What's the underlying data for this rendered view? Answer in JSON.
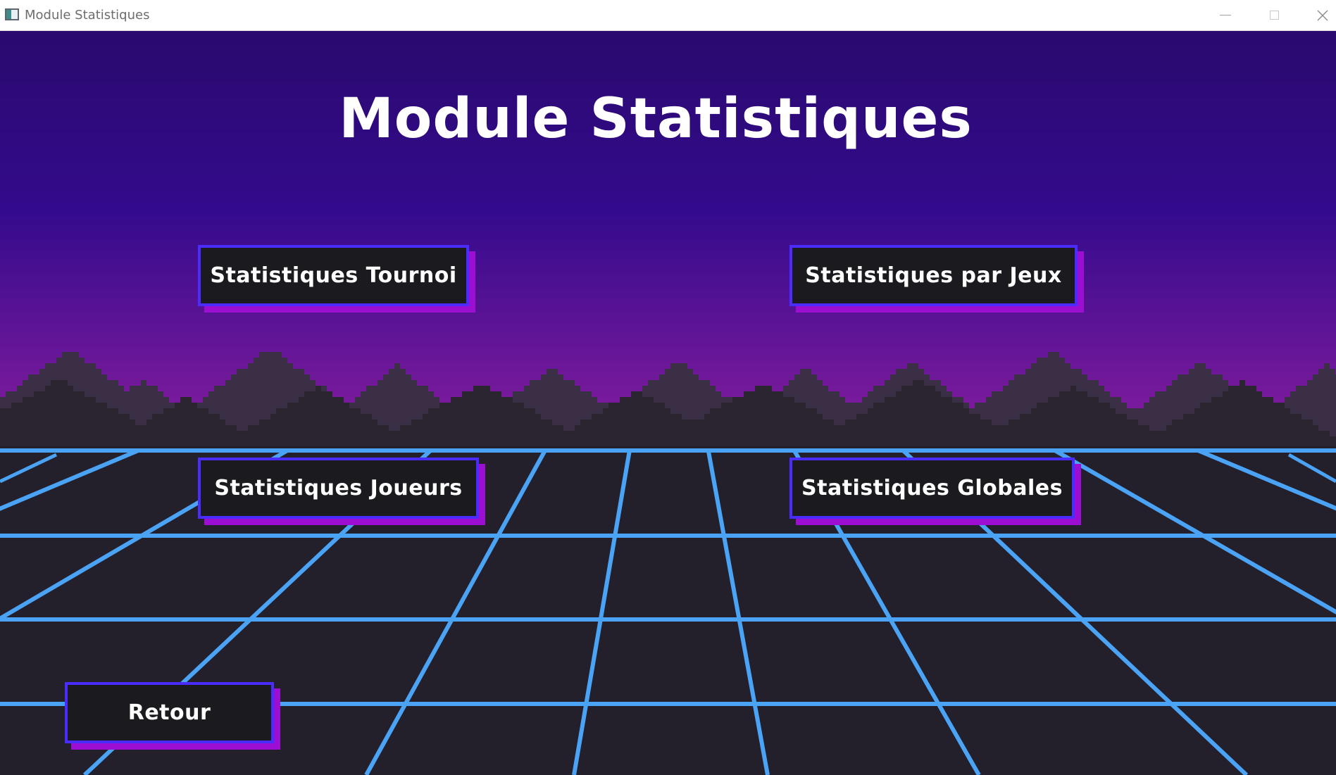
{
  "window": {
    "title": "Module Statistiques",
    "icon": "app-window-icon",
    "controls": [
      "minimize-icon",
      "maximize-icon",
      "close-icon"
    ]
  },
  "page": {
    "title": "Module Statistiques"
  },
  "buttons": {
    "tournoi": "Statistiques Tournoi",
    "jeux": "Statistiques par Jeux",
    "joueurs": "Statistiques Joueurs",
    "globales": "Statistiques Globales",
    "retour": "Retour"
  },
  "colors": {
    "sky_top": "#2a0a6e",
    "sky_mid": "#330a8c",
    "horizon": "#8a1ea0",
    "mountains_far": "#3a2f45",
    "mountains_near": "#2a2530",
    "ground": "#231f2b",
    "grid": "#4aa3f5",
    "button_border": "#4b2cff",
    "button_shadow": "#9c0fd2",
    "button_fill": "#1b1b1f"
  }
}
